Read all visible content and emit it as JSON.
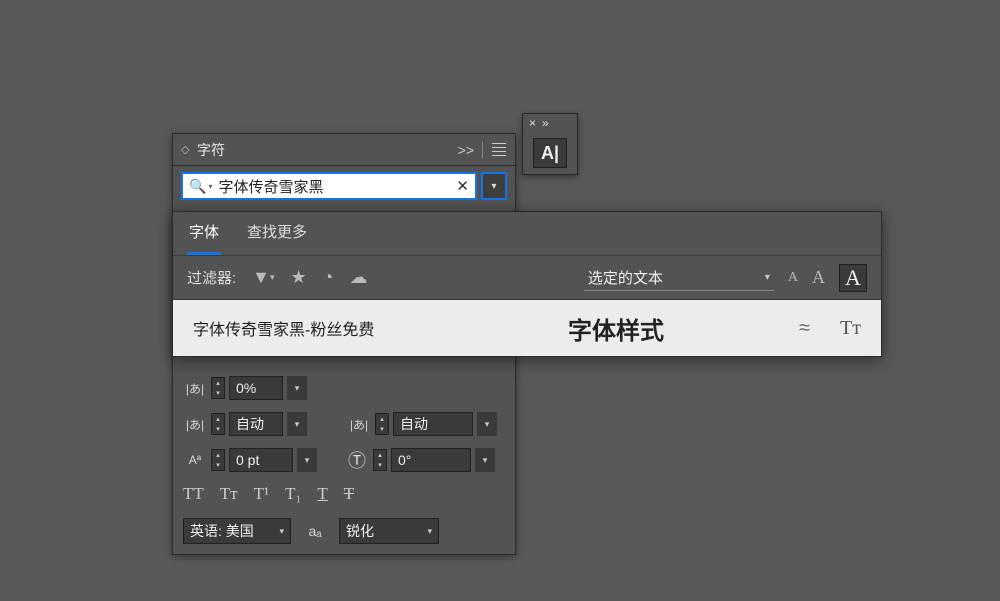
{
  "dock": {
    "close": "×",
    "expand": "»",
    "icon_label": "A|"
  },
  "panel": {
    "title": "字符",
    "expand": ">>",
    "search_value": "字体传奇雪家黑",
    "r_tsume": {
      "value": "0%"
    },
    "kern_left": {
      "value": "自动"
    },
    "kern_right": {
      "value": "自动"
    },
    "baseline": {
      "value": "0 pt"
    },
    "rotate": {
      "value": "0°"
    },
    "styles": {
      "allcaps": "TT",
      "smallcaps": "Tᴛ",
      "superscript": "T¹",
      "subscript": "T₁",
      "underline": "T",
      "strike": "T"
    },
    "language": "英语: 美国",
    "aa_label": "aₐ",
    "aa_value": "锐化"
  },
  "fontpop": {
    "tabs": {
      "fonts": "字体",
      "findmore": "查找更多"
    },
    "filter_label": "过滤器:",
    "selected_text": "选定的文本",
    "result": {
      "name": "字体传奇雪家黑-粉丝免费",
      "sample": "字体样式",
      "approx": "≈",
      "tt": "Tᴛ"
    }
  }
}
